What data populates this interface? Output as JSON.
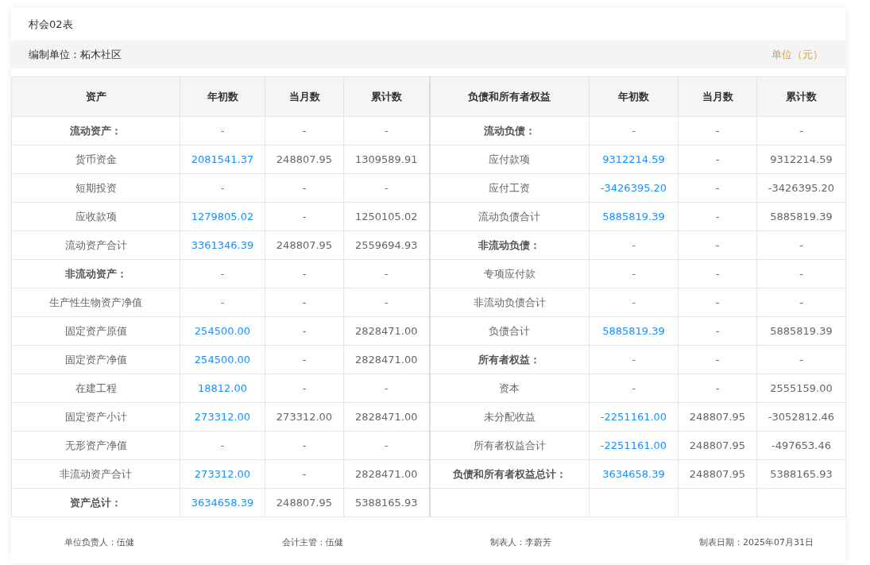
{
  "title": "村会02表",
  "unit_bar": {
    "org": "编制单位：柘木社区",
    "unit": "单位（元）"
  },
  "columns": [
    "资产",
    "年初数",
    "当月数",
    "累计数",
    "负债和所有者权益",
    "年初数",
    "当月数",
    "累计数"
  ],
  "rows": [
    {
      "left": {
        "label": "流动资产：",
        "bold": true,
        "values": [
          "-",
          "-",
          "-"
        ]
      },
      "right": {
        "label": "流动负债：",
        "bold": true,
        "values": [
          "-",
          "-",
          "-"
        ]
      }
    },
    {
      "left": {
        "label": "货币资金",
        "bold": false,
        "values": [
          "2081541.37",
          "248807.95",
          "1309589.91"
        ]
      },
      "right": {
        "label": "应付款项",
        "bold": false,
        "values": [
          "9312214.59",
          "-",
          "9312214.59"
        ]
      }
    },
    {
      "left": {
        "label": "短期投资",
        "bold": false,
        "values": [
          "-",
          "-",
          "-"
        ]
      },
      "right": {
        "label": "应付工资",
        "bold": false,
        "values": [
          "-3426395.20",
          "-",
          "-3426395.20"
        ]
      }
    },
    {
      "left": {
        "label": "应收款项",
        "bold": false,
        "values": [
          "1279805.02",
          "-",
          "1250105.02"
        ]
      },
      "right": {
        "label": "流动负债合计",
        "bold": false,
        "values": [
          "5885819.39",
          "-",
          "5885819.39"
        ]
      }
    },
    {
      "left": {
        "label": "流动资产合计",
        "bold": false,
        "values": [
          "3361346.39",
          "248807.95",
          "2559694.93"
        ]
      },
      "right": {
        "label": "非流动负债：",
        "bold": true,
        "values": [
          "-",
          "-",
          "-"
        ]
      }
    },
    {
      "left": {
        "label": "非流动资产：",
        "bold": true,
        "values": [
          "-",
          "-",
          "-"
        ]
      },
      "right": {
        "label": "专项应付款",
        "bold": false,
        "values": [
          "-",
          "-",
          "-"
        ]
      }
    },
    {
      "left": {
        "label": "生产性生物资产净值",
        "bold": false,
        "values": [
          "-",
          "-",
          "-"
        ]
      },
      "right": {
        "label": "非流动负债合计",
        "bold": false,
        "values": [
          "-",
          "-",
          "-"
        ]
      }
    },
    {
      "left": {
        "label": "固定资产原值",
        "bold": false,
        "values": [
          "254500.00",
          "-",
          "2828471.00"
        ]
      },
      "right": {
        "label": "负债合计",
        "bold": false,
        "values": [
          "5885819.39",
          "-",
          "5885819.39"
        ]
      }
    },
    {
      "left": {
        "label": "固定资产净值",
        "bold": false,
        "values": [
          "254500.00",
          "-",
          "2828471.00"
        ]
      },
      "right": {
        "label": "所有者权益：",
        "bold": true,
        "values": [
          "-",
          "-",
          "-"
        ]
      }
    },
    {
      "left": {
        "label": "在建工程",
        "bold": false,
        "values": [
          "18812.00",
          "-",
          "-"
        ]
      },
      "right": {
        "label": "资本",
        "bold": false,
        "values": [
          "-",
          "-",
          "2555159.00"
        ]
      }
    },
    {
      "left": {
        "label": "固定资产小计",
        "bold": false,
        "values": [
          "273312.00",
          "273312.00",
          "2828471.00"
        ]
      },
      "right": {
        "label": "未分配收益",
        "bold": false,
        "values": [
          "-2251161.00",
          "248807.95",
          "-3052812.46"
        ]
      }
    },
    {
      "left": {
        "label": "无形资产净值",
        "bold": false,
        "values": [
          "-",
          "-",
          "-"
        ]
      },
      "right": {
        "label": "所有者权益合计",
        "bold": false,
        "values": [
          "-2251161.00",
          "248807.95",
          "-497653.46"
        ]
      }
    },
    {
      "left": {
        "label": "非流动资产合计",
        "bold": false,
        "values": [
          "273312.00",
          "-",
          "2828471.00"
        ]
      },
      "right": {
        "label": "负债和所有者权益总计：",
        "bold": true,
        "values": [
          "3634658.39",
          "248807.95",
          "5388165.93"
        ]
      }
    },
    {
      "left": {
        "label": "资产总计：",
        "bold": true,
        "values": [
          "3634658.39",
          "248807.95",
          "5388165.93"
        ]
      }
    }
  ],
  "footer": [
    "单位负责人：伍健",
    "会计主管：伍健",
    "制表人：李蔚芳",
    "制表日期：2025年07月31日"
  ]
}
